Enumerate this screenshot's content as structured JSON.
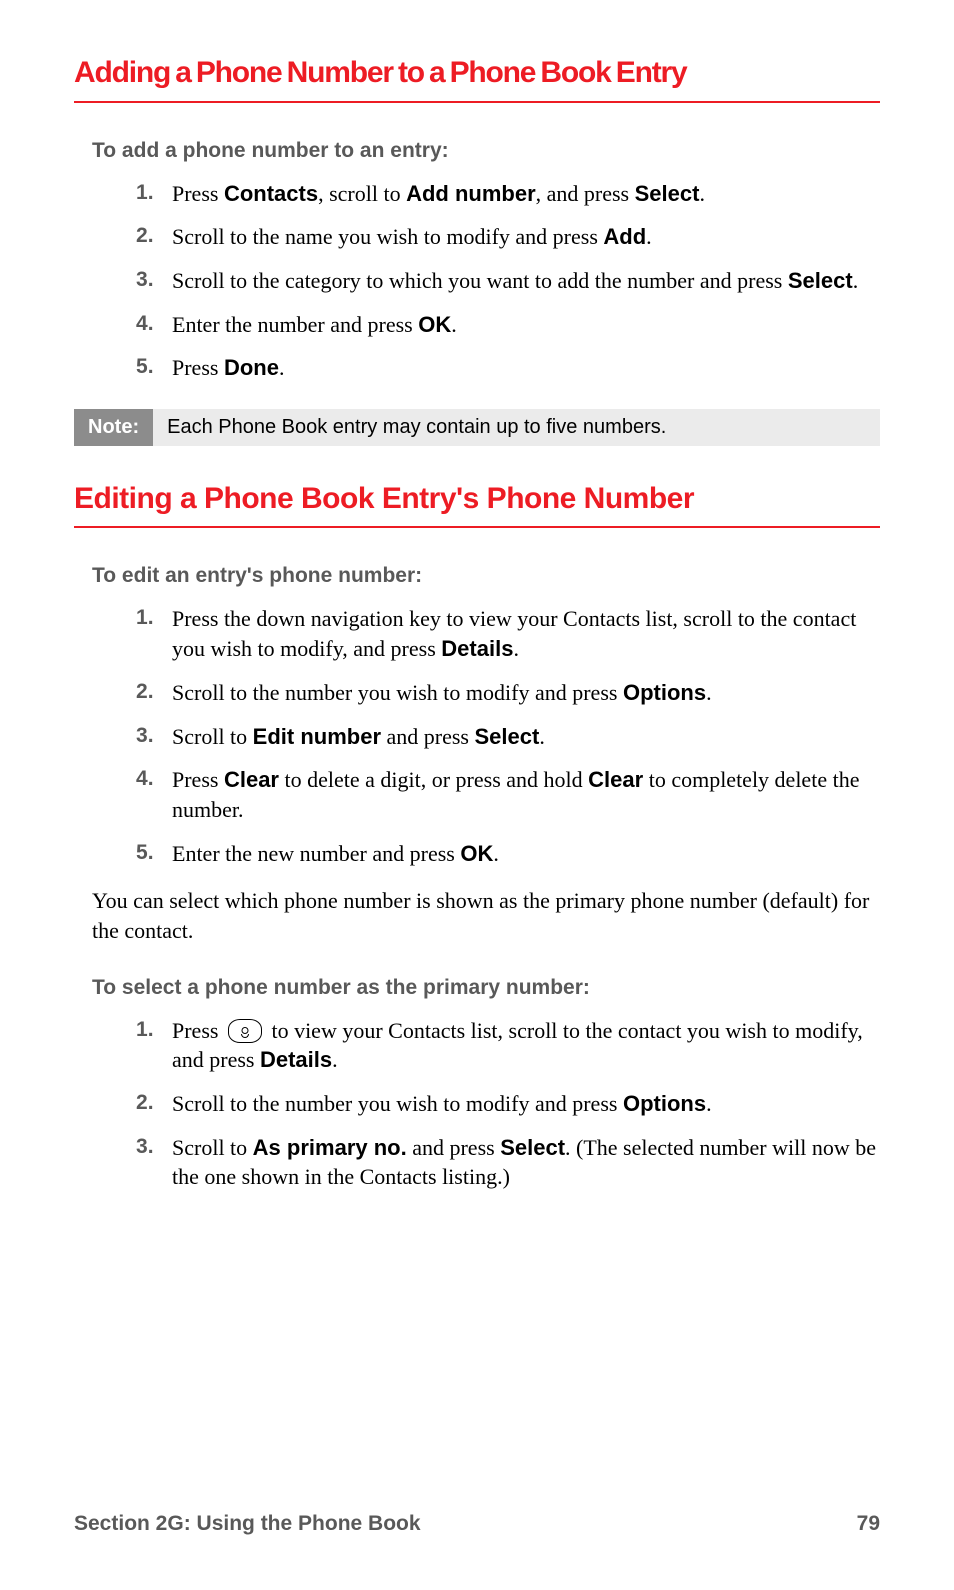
{
  "section1": {
    "heading": "Adding a Phone Number to a Phone Book Entry",
    "intro": "To add a phone number to an entry:",
    "steps": [
      {
        "pre": "Press ",
        "b1": "Contacts",
        "mid1": ", scroll to ",
        "b2": "Add number",
        "mid2": ", and press ",
        "b3": "Select",
        "post": "."
      },
      {
        "pre": "Scroll to the name you wish to modify and press ",
        "b1": "Add",
        "post": "."
      },
      {
        "pre": "Scroll to the category to which you want to add the number and press ",
        "b1": "Select",
        "post": "."
      },
      {
        "pre": "Enter the number and press ",
        "b1": "OK",
        "post": "."
      },
      {
        "pre": "Press ",
        "b1": "Done",
        "post": "."
      }
    ]
  },
  "note": {
    "label": "Note:",
    "text": "Each Phone Book entry may contain up to five numbers."
  },
  "section2": {
    "heading": "Editing a Phone Book Entry's Phone Number",
    "intro": "To edit an entry's phone number:",
    "steps": [
      {
        "pre": "Press the down navigation key to view your Contacts list, scroll to the contact you wish to modify, and press ",
        "b1": "Details",
        "post": "."
      },
      {
        "pre": "Scroll to the number you wish to modify and press ",
        "b1": "Options",
        "post": "."
      },
      {
        "pre": "Scroll to ",
        "b1": "Edit number",
        "mid1": " and press ",
        "b2": "Select",
        "post": "."
      },
      {
        "pre": "Press ",
        "b1": "Clear",
        "mid1": " to delete a digit, or press and hold ",
        "b2": "Clear",
        "post": " to completely delete the number."
      },
      {
        "pre": "Enter the new number and press ",
        "b1": "OK",
        "post": "."
      }
    ],
    "body": "You can select which phone number is shown as the primary phone number (default) for the contact.",
    "intro2": "To select a phone number as the primary number:",
    "steps2": [
      {
        "pre": "Press ",
        "icon": true,
        "mid1": " to view your Contacts list, scroll to the contact you wish to modify, and press ",
        "b1": "Details",
        "post": "."
      },
      {
        "pre": "Scroll to the number you wish to modify and press ",
        "b1": "Options",
        "post": "."
      },
      {
        "pre": "Scroll to ",
        "b1": "As primary no.",
        "mid1": " and press ",
        "b2": "Select",
        "post": ". (The selected number will now be the one shown in the Contacts listing.)"
      }
    ]
  },
  "footer": {
    "section": "Section 2G: Using the Phone Book",
    "page": "79"
  }
}
